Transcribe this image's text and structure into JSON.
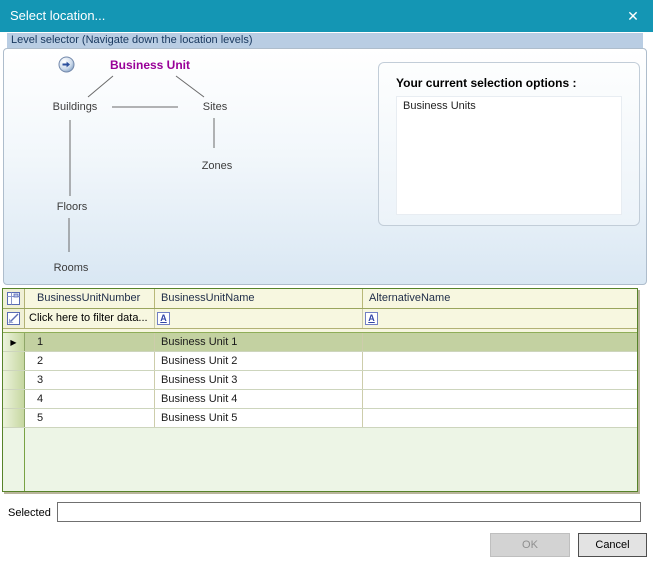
{
  "colors": {
    "titlebar_teal": "#1496b4",
    "level_bar_blue": "#b9cde3",
    "accent_purple": "#990098",
    "grid_border_green": "#57832a",
    "selected_row_green": "#c3d1a1",
    "grid_header_cream": "#f7f7e0"
  },
  "window": {
    "title": "Select location...",
    "close_icon": "✕"
  },
  "level_selector": {
    "header": "Level selector (Navigate down the location levels)"
  },
  "diagram": {
    "nav_icon": "circle-arrow-right",
    "nodes": [
      {
        "label": "Business Unit"
      },
      {
        "label": "Buildings"
      },
      {
        "label": "Sites"
      },
      {
        "label": "Zones"
      },
      {
        "label": "Floors"
      },
      {
        "label": "Rooms"
      }
    ]
  },
  "selection_panel": {
    "title": "Your current selection options :",
    "items": [
      "Business Units"
    ]
  },
  "grid": {
    "corner_icon": "grid-customize-icon",
    "filter_icon": "filter-edit-icon",
    "text_filter_icon": "A",
    "columns": [
      "BusinessUnitNumber",
      "BusinessUnitName",
      "AlternativeName"
    ],
    "filter_prompt": "Click here to filter data...",
    "selected_row_number": "1",
    "rows": [
      {
        "indicator": "▶",
        "number": "1",
        "name": "Business Unit 1",
        "alternative": ""
      },
      {
        "indicator": "",
        "number": "2",
        "name": "Business Unit 2",
        "alternative": ""
      },
      {
        "indicator": "",
        "number": "3",
        "name": "Business Unit 3",
        "alternative": ""
      },
      {
        "indicator": "",
        "number": "4",
        "name": "Business Unit 4",
        "alternative": ""
      },
      {
        "indicator": "",
        "number": "5",
        "name": "Business Unit 5",
        "alternative": ""
      }
    ]
  },
  "footer": {
    "selected_label": "Selected",
    "selected_value": "",
    "ok_label": "OK",
    "cancel_label": "Cancel"
  }
}
